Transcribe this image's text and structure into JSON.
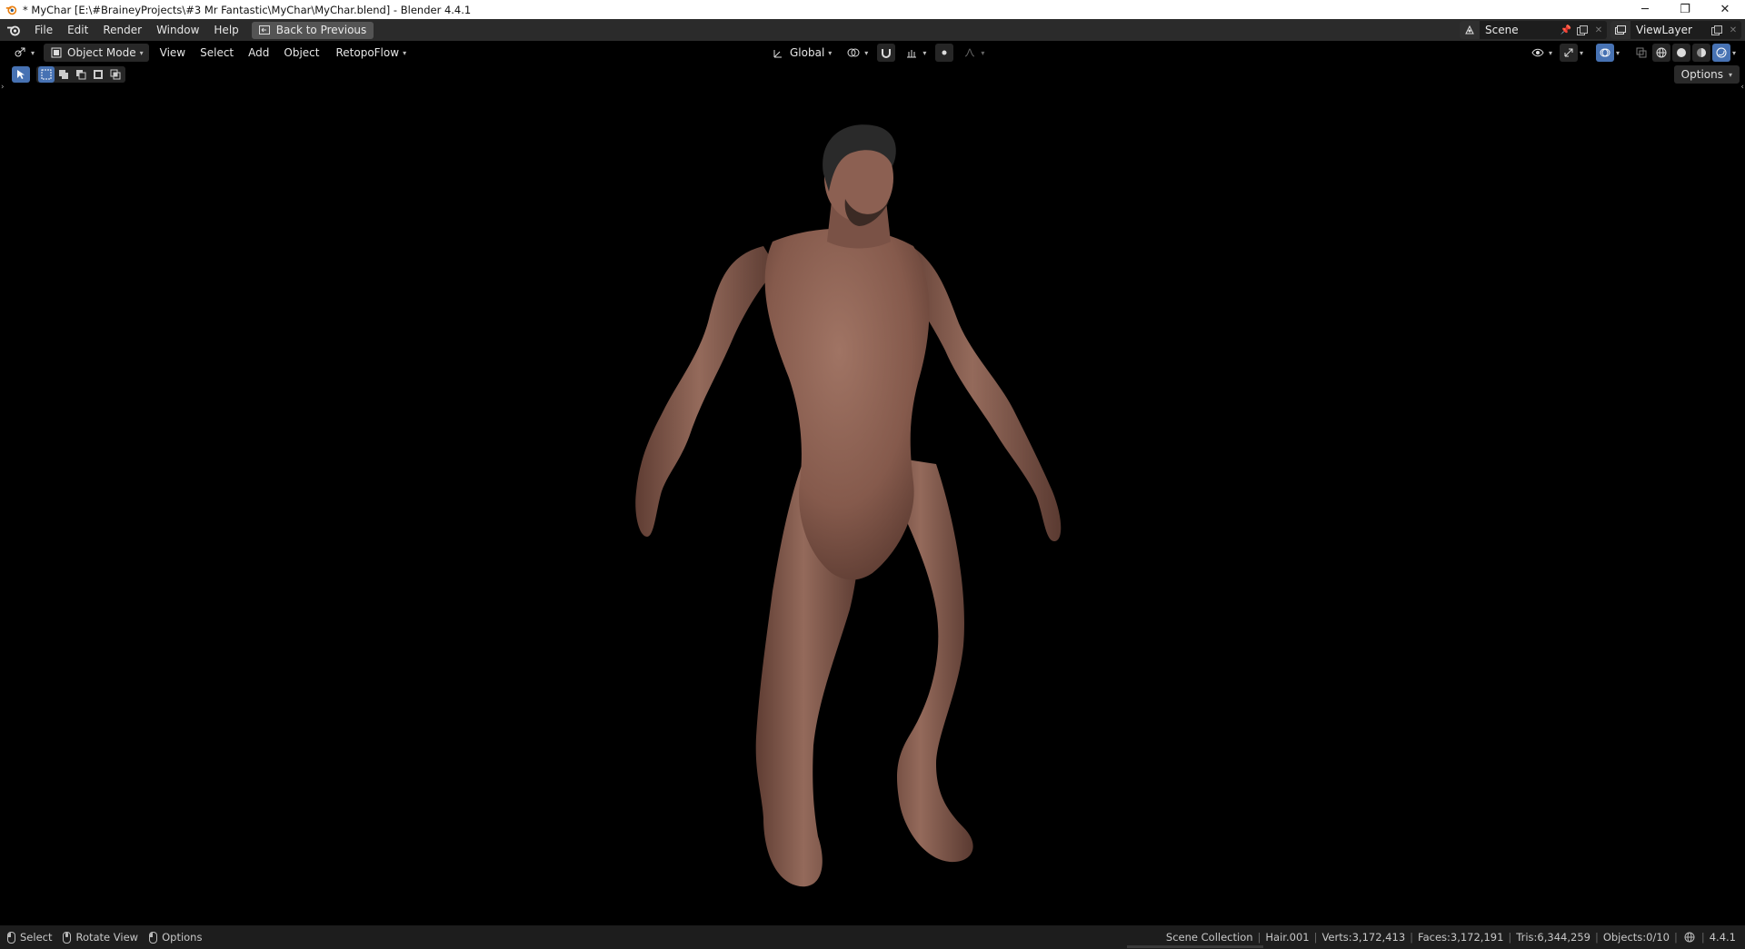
{
  "window": {
    "title": "* MyChar [E:\\#BraineyProjects\\#3 Mr Fantastic\\MyChar\\MyChar.blend] - Blender 4.4.1",
    "controls": [
      "─",
      "❐",
      "✕"
    ]
  },
  "topbar": {
    "menus": [
      "File",
      "Edit",
      "Render",
      "Window",
      "Help"
    ],
    "back_button": "Back to Previous",
    "scene": "Scene",
    "view_layer": "ViewLayer"
  },
  "viewport_header": {
    "mode": "Object Mode",
    "menus": [
      "View",
      "Select",
      "Add",
      "Object"
    ],
    "addon_menu": "RetopoFlow",
    "orientation": "Global"
  },
  "tool_settings": {
    "options_label": "Options"
  },
  "statusbar": {
    "hints": [
      "Select",
      "Rotate View",
      "Options"
    ],
    "stats": [
      "Scene Collection",
      "Hair.001",
      "Verts:3,172,413",
      "Faces:3,172,191",
      "Tris:6,344,259",
      "Objects:0/10"
    ],
    "version": "4.4.1"
  },
  "colors": {
    "accent": "#4772b3",
    "header_bg": "#2b2b2b",
    "viewport_bg": "#000000",
    "skin": "#8a5e50"
  }
}
